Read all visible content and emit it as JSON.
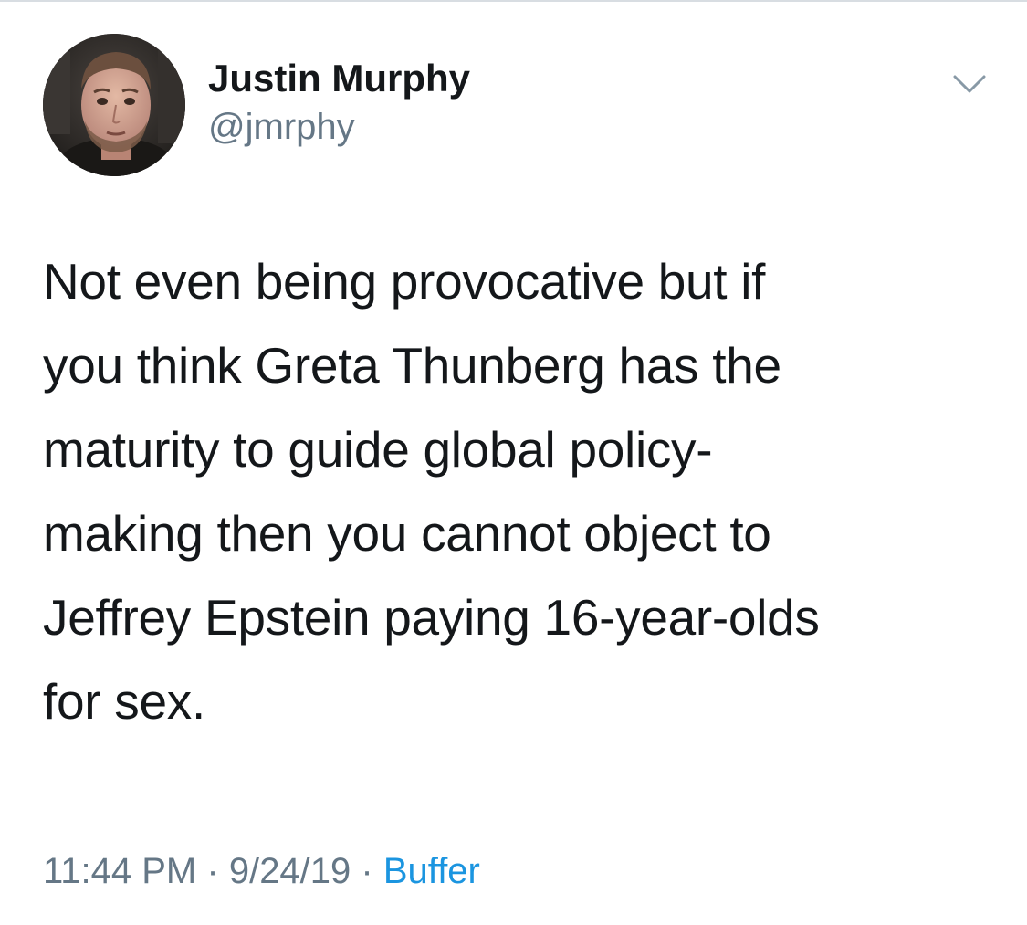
{
  "tweet": {
    "author": {
      "display_name": "Justin Murphy",
      "handle": "@jmrphy",
      "avatar_icon": "profile-photo"
    },
    "menu_icon": "chevron-down-icon",
    "text_lines": [
      "Not even being provocative but if",
      "you think Greta Thunberg has the",
      "maturity to guide global policy-",
      "making then you cannot object to",
      "Jeffrey Epstein paying 16-year-olds",
      "for sex."
    ],
    "time": "11:44 PM",
    "date": "9/24/19",
    "separator": "·",
    "source": "Buffer"
  },
  "colors": {
    "text": "#14171a",
    "secondary": "#657786",
    "link": "#1b95e0",
    "background": "#ffffff"
  }
}
